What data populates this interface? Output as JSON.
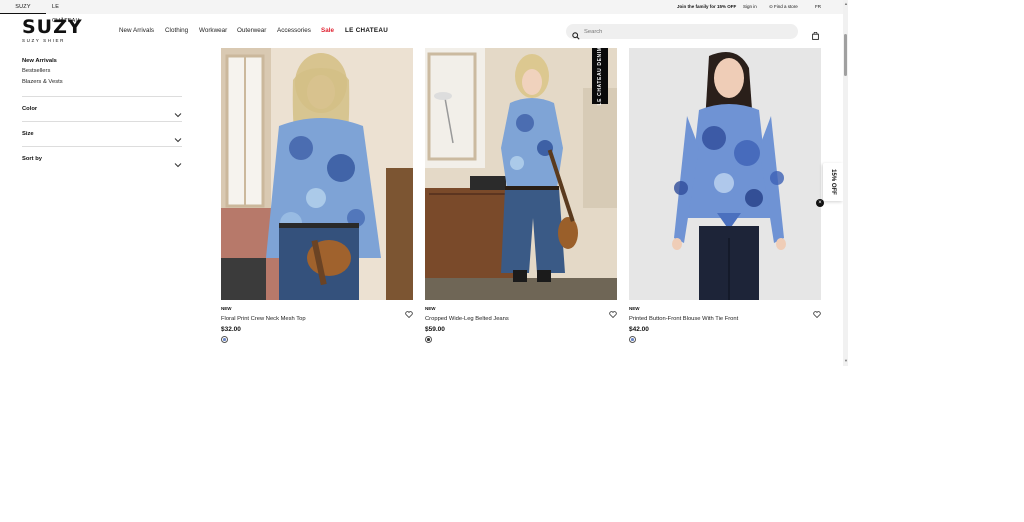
{
  "topbar": {
    "tabs": [
      {
        "label": "SUZY",
        "active": true
      },
      {
        "label": "LE CHÂTEAU",
        "active": false
      }
    ],
    "join_text": "Join the family for 15% OFF",
    "signin_label": "Sign in",
    "find_store_label": "Find a store",
    "language_label": "FR"
  },
  "header": {
    "logo_main": "SUZY",
    "logo_sub": "SUZY SHIER",
    "nav": [
      "New Arrivals",
      "Clothing",
      "Workwear",
      "Outerwear",
      "Accessories",
      "Sale",
      "LE CHATEAU"
    ],
    "search_placeholder": "Search",
    "sale_color": "#e0202f"
  },
  "sidebar": {
    "links": [
      "New Arrivals",
      "Bestsellers",
      "Blazers & Vests"
    ],
    "filters": [
      "Color",
      "Size",
      "Sort by"
    ]
  },
  "products": [
    {
      "badge": "NEW",
      "name": "Floral Print Crew Neck Mesh Top",
      "price": "$32.00",
      "swatch": "blue"
    },
    {
      "badge": "NEW",
      "name": "Cropped Wide-Leg Belted Jeans",
      "price": "$59.00",
      "swatch": "dark"
    },
    {
      "badge": "NEW",
      "name": "Printed Button-Front Blouse With Tie Front",
      "price": "$42.00",
      "swatch": "blue"
    }
  ],
  "brand_tag": "LE CHATEAU DENIM",
  "promo": {
    "label": "15% OFF",
    "close": "×"
  }
}
